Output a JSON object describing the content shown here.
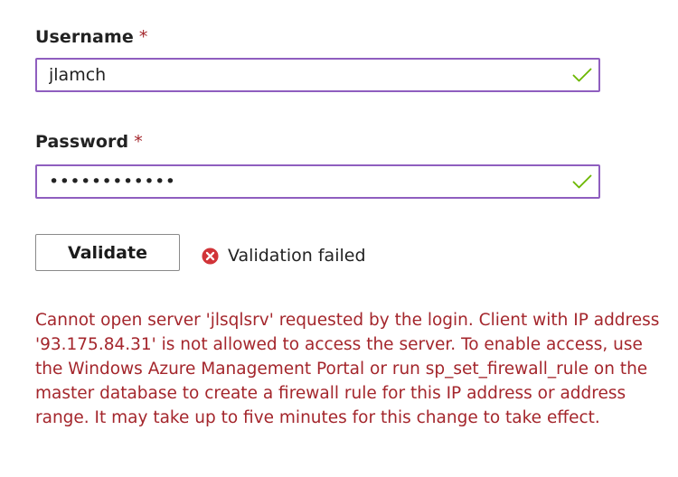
{
  "colors": {
    "input_border": "#8f5ebf",
    "valid_check": "#6bb700",
    "error": "#a4262c",
    "error_icon": "#d13438",
    "text": "#222222"
  },
  "username": {
    "label": "Username",
    "required_marker": "*",
    "value": "jlamch",
    "status_icon": "check-icon"
  },
  "password": {
    "label": "Password",
    "required_marker": "*",
    "value": "••••••••••••",
    "status_icon": "check-icon"
  },
  "validate": {
    "button_label": "Validate",
    "status_icon": "error-circle-x-icon",
    "status_text": "Validation failed"
  },
  "error_message": "Cannot open server 'jlsqlsrv' requested by the login. Client with IP address '93.175.84.31' is not allowed to access the server. To enable access, use the Windows Azure Management Portal or run sp_set_firewall_rule on the master database to create a firewall rule for this IP address or address range. It may take up to five minutes for this change to take effect."
}
